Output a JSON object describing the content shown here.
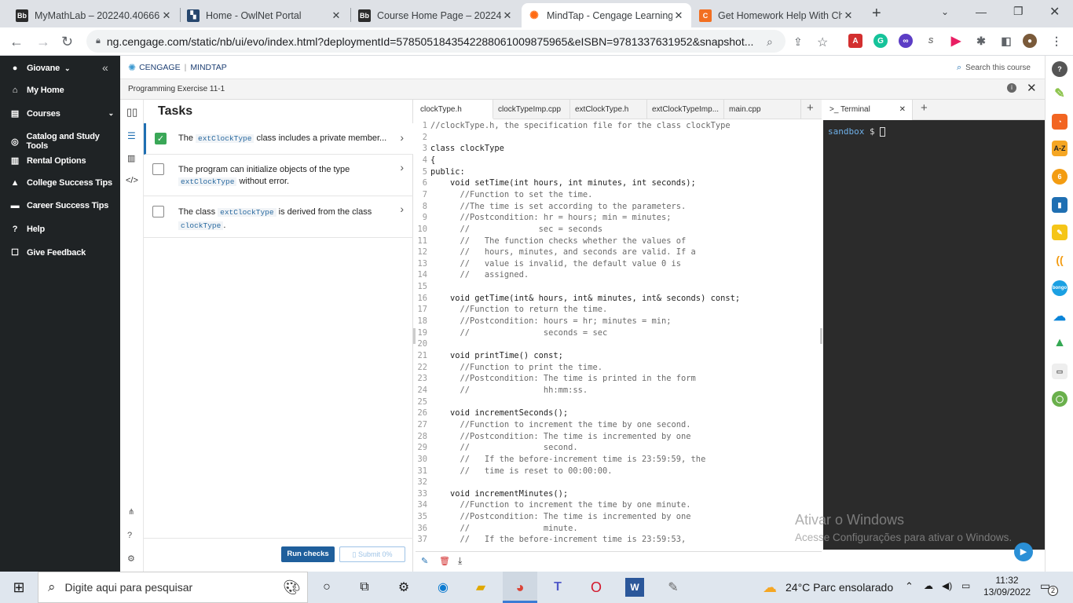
{
  "browser": {
    "tabs": [
      {
        "title": "MyMathLab – 202240.40666",
        "fav_text": "Bb",
        "fav_color": "#2b2b2b"
      },
      {
        "title": "Home - OwlNet Portal",
        "fav_text": "",
        "fav_color": "#26466d"
      },
      {
        "title": "Course Home Page – 202240",
        "fav_text": "Bb",
        "fav_color": "#2b2b2b"
      },
      {
        "title": "MindTap - Cengage Learning",
        "fav_text": "",
        "fav_color": "#ff6a13"
      },
      {
        "title": "Get Homework Help With Ch",
        "fav_text": "C",
        "fav_color": "#f26f21"
      }
    ],
    "url": "ng.cengage.com/static/nb/ui/evo/index.html?deploymentId=5785051843542288061009875965&eISBN=9781337631952&snapshot..."
  },
  "sidebar": {
    "user": "Giovane",
    "items": [
      {
        "label": "My Home",
        "icon": "home-icon",
        "glyph": "⌂"
      },
      {
        "label": "Courses",
        "icon": "book-icon",
        "glyph": "▤"
      },
      {
        "label": "Catalog and Study Tools",
        "icon": "compass-icon",
        "glyph": "◎"
      },
      {
        "label": "Rental Options",
        "icon": "rental-book-icon",
        "glyph": "▥"
      },
      {
        "label": "College Success Tips",
        "icon": "graduation-cap-icon",
        "glyph": "▲"
      },
      {
        "label": "Career Success Tips",
        "icon": "briefcase-icon",
        "glyph": "▬"
      },
      {
        "label": "Help",
        "icon": "help-icon",
        "glyph": "?"
      },
      {
        "label": "Give Feedback",
        "icon": "feedback-icon",
        "glyph": "☐"
      }
    ]
  },
  "header": {
    "brand": "CENGAGE",
    "product": "MINDTAP",
    "search_placeholder": "Search this course",
    "exercise_title": "Programming Exercise 11-1"
  },
  "tasks": {
    "heading": "Tasks",
    "items": [
      {
        "pre": "The ",
        "code": "extClockType",
        "post": " class includes a private member...",
        "code2": "",
        "post2": "",
        "checked": true
      },
      {
        "pre": "The program can initialize objects of the type ",
        "code": "extClockType",
        "post": " without error.",
        "code2": "",
        "post2": "",
        "checked": false
      },
      {
        "pre": "The class ",
        "code": "extClockType",
        "post": " is derived from the class ",
        "code2": "clockType",
        "post2": ".",
        "checked": false
      }
    ],
    "run_checks": "Run checks",
    "submit": "Submit 0%"
  },
  "editor": {
    "tabs": [
      "clockType.h",
      "clockTypeImp.cpp",
      "extClockType.h",
      "extClockTypeImp...",
      "main.cpp"
    ],
    "lines": [
      "//clockType.h, the specification file for the class clockType",
      "",
      "class clockType",
      "{",
      "public:",
      "    void setTime(int hours, int minutes, int seconds);",
      "      //Function to set the time.",
      "      //The time is set according to the parameters.",
      "      //Postcondition: hr = hours; min = minutes;",
      "      //              sec = seconds",
      "      //   The function checks whether the values of",
      "      //   hours, minutes, and seconds are valid. If a",
      "      //   value is invalid, the default value 0 is",
      "      //   assigned.",
      "",
      "    void getTime(int& hours, int& minutes, int& seconds) const;",
      "      //Function to return the time.",
      "      //Postcondition: hours = hr; minutes = min;",
      "      //               seconds = sec",
      "",
      "    void printTime() const;",
      "      //Function to print the time.",
      "      //Postcondition: The time is printed in the form",
      "      //               hh:mm:ss.",
      "",
      "    void incrementSeconds();",
      "      //Function to increment the time by one second.",
      "      //Postcondition: The time is incremented by one",
      "      //               second.",
      "      //   If the before-increment time is 23:59:59, the",
      "      //   time is reset to 00:00:00.",
      "",
      "    void incrementMinutes();",
      "      //Function to increment the time by one minute.",
      "      //Postcondition: The time is incremented by one",
      "      //               minute.",
      "      //   If the before-increment time is 23:59:53,"
    ]
  },
  "terminal": {
    "tab": "Terminal",
    "prompt_user": "sandbox",
    "prompt_symbol": "$"
  },
  "watermark": {
    "line1": "Ativar o Windows",
    "line2": "Acesse Configurações para ativar o Windows."
  },
  "taskbar": {
    "search_placeholder": "Digite aqui para pesquisar",
    "weather": "24°C  Parc ensolarado",
    "time": "11:32",
    "date": "13/09/2022",
    "notifications": "2"
  }
}
